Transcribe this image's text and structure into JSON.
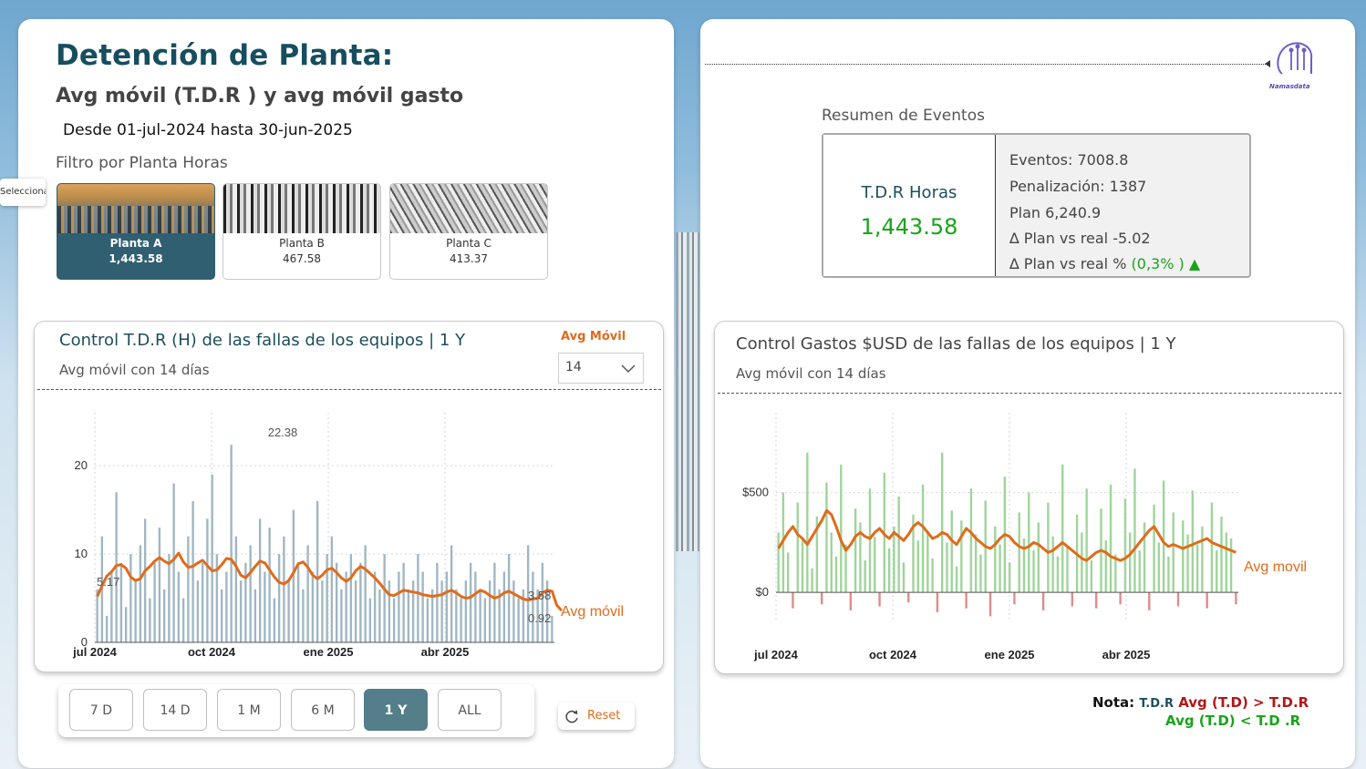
{
  "header": {
    "title": "Detención de Planta:",
    "subtitle": "Avg móvil (T.D.R ) y avg móvil gasto",
    "date_range": "Desde 01-jul-2024 hasta 30-jun-2025",
    "filter_label": "Filtro por Planta Horas",
    "tooltip": "Seleccionado"
  },
  "plants": [
    {
      "name": "Planta A",
      "value": "1,443.58",
      "selected": true
    },
    {
      "name": "Planta B",
      "value": "467.58",
      "selected": false
    },
    {
      "name": "Planta C",
      "value": "413.37",
      "selected": false
    }
  ],
  "chart_left": {
    "title": "Control T.D.R (H) de las fallas de los equipos | 1 Y",
    "subtitle": "Avg móvil con 14 días",
    "dropdown_label": "Avg Móvil",
    "dropdown_value": "14",
    "series_label": "Avg móvil"
  },
  "chart_right": {
    "title": "Control Gastos $USD de las fallas de los equipos | 1 Y",
    "subtitle": "Avg móvil con 14 días",
    "series_label": "Avg movil"
  },
  "chart_data": [
    {
      "type": "bar",
      "title": "Control T.D.R (H) de las fallas de los equipos | 1 Y",
      "x_ticks": [
        "jul 2024",
        "oct 2024",
        "ene 2025",
        "abr 2025"
      ],
      "y_ticks": [
        "0",
        "10",
        "20"
      ],
      "ylim": [
        0,
        26
      ],
      "series": [
        {
          "name": "Avg móvil",
          "kind": "line",
          "color": "#e06b1b",
          "values": [
            5.2,
            6.4,
            7.5,
            8.0,
            8.7,
            8.8,
            8.4,
            7.4,
            7.0,
            7.2,
            8.1,
            8.6,
            9.2,
            9.6,
            9.2,
            8.9,
            9.4,
            10.1,
            9.1,
            8.5,
            8.6,
            9.0,
            9.3,
            8.7,
            8.1,
            8.2,
            8.8,
            9.5,
            9.4,
            8.6,
            7.6,
            7.3,
            7.9,
            8.6,
            9.2,
            9.0,
            8.2,
            7.4,
            6.8,
            6.6,
            7.0,
            7.9,
            8.9,
            9.1,
            8.5,
            7.6,
            7.2,
            7.6,
            8.2,
            8.4,
            7.9,
            7.3,
            6.9,
            7.3,
            8.1,
            8.6,
            8.3,
            7.8,
            7.3,
            6.7,
            6.0,
            5.4,
            5.3,
            5.6,
            5.9,
            5.8,
            5.7,
            5.6,
            5.4,
            5.3,
            5.2,
            5.3,
            5.4,
            5.7,
            5.9,
            5.6,
            5.2,
            5.0,
            5.1,
            5.5,
            5.9,
            5.7,
            5.3,
            5.0,
            5.2,
            5.6,
            5.8,
            5.5,
            5.2,
            4.9,
            4.8,
            4.9,
            5.0,
            5.6,
            5.9,
            5.8,
            4.2,
            3.6
          ]
        },
        {
          "name": "T.D.R",
          "kind": "bar",
          "color": "#9fb7c2",
          "values": [
            6,
            12,
            3,
            8,
            17,
            9,
            4,
            10,
            7,
            11,
            14,
            5,
            9,
            13,
            6,
            10,
            18,
            8,
            5,
            12,
            16,
            7,
            9,
            14,
            19,
            10,
            6,
            8,
            22.38,
            12,
            7,
            9,
            11,
            6,
            14,
            8,
            13,
            5,
            10,
            12,
            7,
            15,
            9,
            6,
            11,
            8,
            16,
            7,
            10,
            12,
            9,
            6,
            8,
            10,
            7,
            9,
            11,
            5,
            8,
            6,
            10,
            7,
            5,
            8,
            9,
            6,
            7,
            10,
            8,
            5,
            6,
            9,
            7,
            8,
            11,
            6,
            5,
            7,
            9,
            8,
            6,
            5,
            7,
            9,
            6,
            8,
            10,
            7,
            5,
            6,
            11,
            8,
            6,
            9,
            7,
            3
          ]
        }
      ],
      "annotations": [
        "22.38",
        "5.17",
        "3.58",
        "0.92"
      ]
    },
    {
      "type": "bar",
      "title": "Control Gastos $USD de las fallas de los equipos | 1 Y",
      "x_ticks": [
        "jul 2024",
        "oct 2024",
        "ene 2025",
        "abr 2025"
      ],
      "y_ticks": [
        "$0",
        "$500"
      ],
      "ylim": [
        -150,
        900
      ],
      "series": [
        {
          "name": "Avg movil",
          "kind": "line",
          "color": "#e06b1b",
          "values": [
            220,
            260,
            300,
            330,
            290,
            270,
            240,
            280,
            320,
            360,
            410,
            390,
            330,
            260,
            210,
            240,
            280,
            300,
            280,
            270,
            300,
            320,
            290,
            270,
            300,
            280,
            260,
            290,
            330,
            350,
            330,
            300,
            270,
            280,
            300,
            290,
            260,
            240,
            280,
            320,
            300,
            270,
            250,
            230,
            220,
            240,
            270,
            290,
            280,
            250,
            230,
            220,
            230,
            250,
            240,
            220,
            200,
            210,
            230,
            250,
            230,
            210,
            190,
            170,
            160,
            180,
            200,
            210,
            200,
            180,
            170,
            160,
            170,
            190,
            220,
            250,
            280,
            310,
            330,
            290,
            250,
            230,
            240,
            230,
            220,
            230,
            240,
            250,
            260,
            270,
            250,
            240,
            230,
            220,
            210,
            200
          ]
        },
        {
          "name": "Gastos",
          "kind": "bar",
          "color": "#9fd49a",
          "negative_color": "#e28a8a",
          "values": [
            300,
            500,
            200,
            -80,
            450,
            260,
            700,
            120,
            380,
            -60,
            550,
            300,
            180,
            640,
            240,
            -90,
            420,
            350,
            160,
            520,
            280,
            -70,
            600,
            220,
            330,
            480,
            150,
            -50,
            390,
            260,
            540,
            310,
            170,
            -100,
            700,
            250,
            410,
            130,
            360,
            -80,
            520,
            290,
            190,
            460,
            -120,
            330,
            240,
            580,
            150,
            -60,
            400,
            270,
            500,
            210,
            350,
            -90,
            450,
            280,
            180,
            640,
            230,
            -70,
            390,
            300,
            520,
            160,
            -80,
            420,
            260,
            540,
            190,
            -60,
            470,
            300,
            620,
            210,
            350,
            -90,
            440,
            250,
            560,
            180,
            400,
            -70,
            360,
            290,
            510,
            240,
            330,
            -80,
            450,
            210,
            380,
            300,
            270,
            -60
          ]
        }
      ]
    }
  ],
  "time_buttons": [
    {
      "label": "7 D",
      "active": false
    },
    {
      "label": "14 D",
      "active": false
    },
    {
      "label": "1 M",
      "active": false
    },
    {
      "label": "6 M",
      "active": false
    },
    {
      "label": "1 Y",
      "active": true
    },
    {
      "label": "ALL",
      "active": false
    }
  ],
  "reset_label": "Reset",
  "logo_text": "Namasdata",
  "summary": {
    "heading": "Resumen de Eventos",
    "kpi_label": "T.D.R Horas",
    "kpi_value": "1,443.58",
    "eventos": "Eventos: 7008.8",
    "penalizacion": "Penalización: 1387",
    "plan": "Plan 6,240.9",
    "delta": "∆ Plan vs real -5.02",
    "delta_pct_label": "∆ Plan vs real %",
    "delta_pct_value": "(0,3% )",
    "delta_arrow": "▲"
  },
  "note": {
    "label": "Nota:",
    "line1_a": "T.D.R",
    "line1_b": "Avg (T.D) > T.D.R",
    "line2": "Avg (T.D) < T.D .R"
  },
  "colors": {
    "accent": "#164e5f",
    "orange": "#e06b1b",
    "green": "#1aa31a",
    "red": "#b01818",
    "selected": "#2f5f70"
  }
}
